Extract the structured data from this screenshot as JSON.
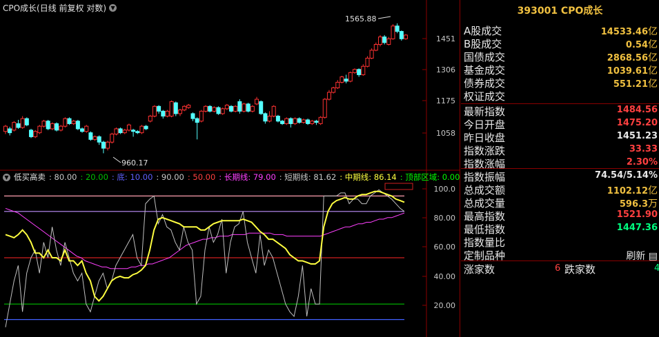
{
  "title": "CPO成长(日线 前复权 对数)",
  "chart_data": [
    {
      "type": "candlestick",
      "y_ticks": [
        "1451",
        "1306",
        "1175",
        "1058"
      ],
      "y_log": true,
      "annotations": {
        "high": "1565.88",
        "low": "960.17"
      },
      "candles": [
        [
          1040,
          1060,
          1030,
          1065
        ],
        [
          1050,
          1035,
          1025,
          1058
        ],
        [
          1045,
          1075,
          1040,
          1080
        ],
        [
          1070,
          1055,
          1050,
          1085
        ],
        [
          1055,
          1090,
          1050,
          1100
        ],
        [
          1090,
          1065,
          1060,
          1095
        ],
        [
          1045,
          1020,
          1015,
          1050
        ],
        [
          1020,
          1040,
          1015,
          1045
        ],
        [
          1035,
          1060,
          1030,
          1065
        ],
        [
          1060,
          1080,
          1055,
          1085
        ],
        [
          1080,
          1050,
          1045,
          1085
        ],
        [
          1050,
          1070,
          1045,
          1075
        ],
        [
          1070,
          1045,
          1040,
          1075
        ],
        [
          1045,
          1060,
          1040,
          1065
        ],
        [
          1060,
          1090,
          1055,
          1095
        ],
        [
          1090,
          1070,
          1065,
          1095
        ],
        [
          1070,
          1080,
          1065,
          1085
        ],
        [
          1080,
          1050,
          1045,
          1085
        ],
        [
          1050,
          1040,
          1035,
          1055
        ],
        [
          1040,
          1060,
          1035,
          1065
        ],
        [
          1035,
          1010,
          1005,
          1040
        ],
        [
          1010,
          1020,
          1005,
          1025
        ],
        [
          1020,
          1000,
          990,
          1025
        ],
        [
          1000,
          978,
          960,
          1005
        ],
        [
          978,
          1000,
          970,
          1005
        ],
        [
          1000,
          1030,
          995,
          1035
        ],
        [
          1030,
          1050,
          1025,
          1055
        ],
        [
          1050,
          1035,
          1030,
          1055
        ],
        [
          1035,
          1045,
          1030,
          1050
        ],
        [
          1045,
          1065,
          1040,
          1070
        ],
        [
          1045,
          1040,
          1020,
          1050
        ],
        [
          1040,
          1035,
          1030,
          1045
        ],
        [
          1035,
          1060,
          1030,
          1065
        ],
        [
          1060,
          1050,
          1045,
          1065
        ],
        [
          1080,
          1100,
          1075,
          1105
        ],
        [
          1100,
          1140,
          1095,
          1145
        ],
        [
          1140,
          1120,
          1110,
          1145
        ],
        [
          1120,
          1100,
          1090,
          1125
        ],
        [
          1100,
          1120,
          1095,
          1125
        ],
        [
          1100,
          1160,
          1095,
          1165
        ],
        [
          1155,
          1110,
          1100,
          1160
        ],
        [
          1110,
          1125,
          1100,
          1130
        ],
        [
          1125,
          1140,
          1120,
          1145
        ],
        [
          1135,
          1145,
          1130,
          1150
        ],
        [
          1110,
          1090,
          1080,
          1115
        ],
        [
          1090,
          1075,
          1010,
          1095
        ],
        [
          1080,
          1120,
          1075,
          1125
        ],
        [
          1120,
          1140,
          1115,
          1145
        ],
        [
          1140,
          1120,
          1115,
          1145
        ],
        [
          1120,
          1135,
          1115,
          1140
        ],
        [
          1135,
          1110,
          1105,
          1140
        ],
        [
          1110,
          1130,
          1105,
          1135
        ],
        [
          1130,
          1145,
          1125,
          1150
        ],
        [
          1140,
          1120,
          1115,
          1145
        ],
        [
          1120,
          1140,
          1115,
          1145
        ],
        [
          1160,
          1120,
          1110,
          1170
        ],
        [
          1120,
          1150,
          1115,
          1155
        ],
        [
          1150,
          1120,
          1115,
          1155
        ],
        [
          1120,
          1140,
          1115,
          1145
        ],
        [
          1150,
          1170,
          1145,
          1180
        ],
        [
          1160,
          1110,
          1105,
          1165
        ],
        [
          1110,
          1080,
          1070,
          1115
        ],
        [
          1080,
          1100,
          1075,
          1120
        ],
        [
          1100,
          1140,
          1095,
          1145
        ],
        [
          1100,
          1080,
          1075,
          1105
        ],
        [
          1080,
          1070,
          1065,
          1085
        ],
        [
          1070,
          1090,
          1065,
          1095
        ],
        [
          1090,
          1070,
          1055,
          1095
        ],
        [
          1070,
          1090,
          1065,
          1095
        ],
        [
          1090,
          1075,
          1070,
          1095
        ],
        [
          1075,
          1085,
          1070,
          1090
        ],
        [
          1085,
          1070,
          1065,
          1090
        ],
        [
          1070,
          1080,
          1065,
          1085
        ],
        [
          1080,
          1075,
          1065,
          1085
        ],
        [
          1070,
          1095,
          1065,
          1100
        ],
        [
          1095,
          1170,
          1090,
          1175
        ],
        [
          1170,
          1200,
          1165,
          1210
        ],
        [
          1200,
          1220,
          1195,
          1225
        ],
        [
          1220,
          1245,
          1215,
          1255
        ],
        [
          1245,
          1270,
          1240,
          1275
        ],
        [
          1260,
          1250,
          1240,
          1280
        ],
        [
          1250,
          1290,
          1245,
          1295
        ],
        [
          1290,
          1305,
          1285,
          1310
        ],
        [
          1305,
          1280,
          1270,
          1310
        ],
        [
          1280,
          1320,
          1275,
          1330
        ],
        [
          1320,
          1360,
          1315,
          1370
        ],
        [
          1360,
          1400,
          1355,
          1410
        ],
        [
          1400,
          1430,
          1395,
          1440
        ],
        [
          1430,
          1470,
          1420,
          1480
        ],
        [
          1470,
          1440,
          1430,
          1480
        ],
        [
          1430,
          1460,
          1425,
          1470
        ],
        [
          1460,
          1530,
          1455,
          1540
        ],
        [
          1530,
          1500,
          1490,
          1545
        ],
        [
          1500,
          1460,
          1450,
          1505
        ],
        [
          1460,
          1480,
          1455,
          1485
        ]
      ]
    },
    {
      "type": "line",
      "legend": {
        "name": "低买高卖",
        "sep": ":",
        "items": [
          {
            "label": "80.00",
            "color": "#c8c8c8"
          },
          {
            "label": "20.00",
            "color": "#00c000"
          },
          {
            "label": "底: 10.00",
            "color": "#6060ff"
          },
          {
            "label": "90.00",
            "color": "#c8c8c8"
          },
          {
            "label": "50.00",
            "color": "#ff4040"
          },
          {
            "label": "长期线: 79.00",
            "color": "#ff40ff"
          },
          {
            "label": "短期线: 81.62",
            "color": "#c8c8c8"
          },
          {
            "label": "中期线: 86.14",
            "color": "#ffff40"
          },
          {
            "label": "顶部区域: 0.00",
            "color": "#00ff00"
          }
        ]
      },
      "y_ticks": [
        "100.0",
        "80.00",
        "60.00",
        "40.00",
        "20.00"
      ],
      "ylim": [
        0,
        100
      ],
      "hlines": [
        {
          "value": 90,
          "color": "#ff9fb0"
        },
        {
          "value": 80,
          "color": "#c090ff"
        },
        {
          "value": 50,
          "color": "#d02020"
        },
        {
          "value": 20,
          "color": "#00c000"
        },
        {
          "value": 10,
          "color": "#4060ff"
        }
      ],
      "series": [
        {
          "name": "长期线",
          "color": "#ff40ff",
          "values": [
            82,
            81,
            80,
            79,
            77,
            75,
            73,
            71,
            69,
            67,
            65,
            63,
            61,
            59,
            57,
            55,
            53,
            51,
            50,
            48,
            47,
            46,
            45,
            44,
            44,
            43,
            43,
            43,
            43,
            43,
            44,
            44,
            45,
            45,
            46,
            46,
            47,
            48,
            49,
            50,
            52,
            54,
            56,
            58,
            59,
            60,
            61,
            62,
            62,
            63,
            63,
            64,
            64,
            64,
            65,
            65,
            65,
            65,
            66,
            66,
            66,
            66,
            66,
            66,
            65,
            65,
            65,
            64,
            64,
            64,
            64,
            64,
            64,
            64,
            64,
            64,
            65,
            66,
            67,
            68,
            69,
            70,
            70,
            71,
            72,
            72,
            73,
            73,
            74,
            75,
            75,
            76,
            76,
            77,
            78,
            79
          ]
        },
        {
          "name": "短期线",
          "color": "#c0c0c0",
          "values": [
            5,
            20,
            35,
            45,
            15,
            40,
            50,
            55,
            40,
            60,
            50,
            70,
            55,
            45,
            60,
            50,
            40,
            35,
            40,
            20,
            15,
            25,
            35,
            40,
            30,
            35,
            45,
            50,
            55,
            60,
            65,
            50,
            45,
            85,
            88,
            90,
            72,
            78,
            70,
            68,
            60,
            55,
            70,
            60,
            55,
            20,
            25,
            55,
            70,
            60,
            65,
            75,
            40,
            60,
            70,
            72,
            80,
            60,
            50,
            40,
            65,
            45,
            55,
            50,
            40,
            30,
            20,
            15,
            12,
            25,
            45,
            12,
            30,
            20,
            20,
            90,
            90,
            90,
            90,
            92,
            92,
            85,
            88,
            88,
            85,
            85,
            90,
            92,
            94,
            92,
            90,
            88,
            85,
            82,
            80
          ]
        },
        {
          "name": "中期线",
          "color": "#ffff40",
          "values": [
            65,
            64,
            63,
            65,
            68,
            65,
            60,
            53,
            53,
            50,
            55,
            50,
            50,
            48,
            55,
            48,
            48,
            45,
            48,
            40,
            35,
            25,
            22,
            25,
            30,
            35,
            37,
            38,
            37,
            37,
            39,
            40,
            42,
            45,
            55,
            68,
            75,
            76,
            75,
            74,
            73,
            72,
            70,
            70,
            70,
            70,
            68,
            68,
            70,
            72,
            73,
            74,
            74,
            74,
            74,
            74,
            75,
            74,
            73,
            70,
            67,
            65,
            62,
            62,
            60,
            58,
            56,
            52,
            50,
            48,
            48,
            47,
            46,
            46,
            48,
            70,
            80,
            85,
            87,
            88,
            89,
            88,
            88,
            90,
            91,
            91,
            92,
            93,
            93,
            92,
            91,
            90,
            88,
            87,
            86
          ]
        }
      ]
    }
  ],
  "panel": {
    "code": "393001 CPO成长",
    "rows": [
      {
        "label": "A股成交",
        "value": "14533.46",
        "unit": "亿",
        "color": "#f0c040"
      },
      {
        "label": "B股成交",
        "value": "0.54",
        "unit": "亿",
        "color": "#f0c040"
      },
      {
        "label": "国债成交",
        "value": "2868.56",
        "unit": "亿",
        "color": "#f0c040"
      },
      {
        "label": "基金成交",
        "value": "1039.61",
        "unit": "亿",
        "color": "#f0c040"
      },
      {
        "label": "债券成交",
        "value": "551.21",
        "unit": "亿",
        "color": "#f0c040"
      },
      {
        "label": "权证成交",
        "value": "",
        "unit": "",
        "color": "#f0c040"
      },
      {
        "label": "最新指数",
        "value": "1484.56",
        "unit": "",
        "color": "#ff4040"
      },
      {
        "label": "今日开盘",
        "value": "1475.20",
        "unit": "",
        "color": "#ff4040"
      },
      {
        "label": "昨日收盘",
        "value": "1451.23",
        "unit": "",
        "color": "#e8e8e8"
      },
      {
        "label": "指数涨跌",
        "value": "33.33",
        "unit": "",
        "color": "#ff4040"
      },
      {
        "label": "指数涨幅",
        "value": "2.30%",
        "unit": "",
        "color": "#ff4040"
      },
      {
        "label": "指数振幅",
        "value": "74.54/5.14%",
        "unit": "",
        "color": "#e8e8e8"
      },
      {
        "label": "总成交额",
        "value": "1102.12",
        "unit": "亿",
        "color": "#f0c040"
      },
      {
        "label": "总成交量",
        "value": "596.3",
        "unit": "万",
        "color": "#f0c040"
      },
      {
        "label": "最高指数",
        "value": "1521.90",
        "unit": "",
        "color": "#ff4040"
      },
      {
        "label": "最低指数",
        "value": "1447.36",
        "unit": "",
        "color": "#00ff80"
      },
      {
        "label": "指数量比",
        "value": "",
        "unit": "",
        "color": "#e8e8e8"
      },
      {
        "label": "定制品种",
        "value": "刷新",
        "unit": "",
        "color": "#e8e8e8"
      }
    ],
    "footer": {
      "up_label": "涨家数",
      "up_count": "6",
      "down_label": "跌家数",
      "down_count": "4"
    }
  }
}
